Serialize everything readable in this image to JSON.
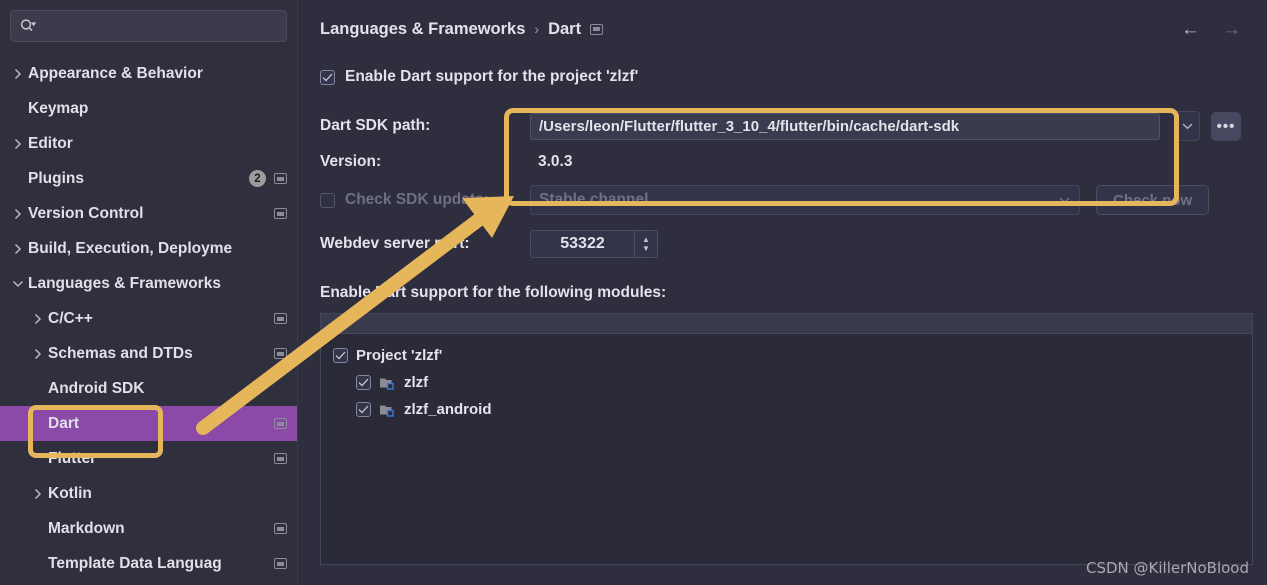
{
  "sidebar": {
    "search": {
      "placeholder": "",
      "value": "",
      "icon": "search-icon"
    },
    "items": [
      {
        "label": "Appearance & Behavior",
        "indent": 0,
        "chevron": "collapsed",
        "badge": null,
        "scope_icon": false,
        "selected": false
      },
      {
        "label": "Keymap",
        "indent": 0,
        "chevron": "none",
        "badge": null,
        "scope_icon": false,
        "selected": false
      },
      {
        "label": "Editor",
        "indent": 0,
        "chevron": "collapsed",
        "badge": null,
        "scope_icon": false,
        "selected": false
      },
      {
        "label": "Plugins",
        "indent": 0,
        "chevron": "none",
        "badge": "2",
        "scope_icon": true,
        "selected": false
      },
      {
        "label": "Version Control",
        "indent": 0,
        "chevron": "collapsed",
        "badge": null,
        "scope_icon": true,
        "selected": false
      },
      {
        "label": "Build, Execution, Deployme",
        "indent": 0,
        "chevron": "collapsed",
        "badge": null,
        "scope_icon": false,
        "selected": false
      },
      {
        "label": "Languages & Frameworks",
        "indent": 0,
        "chevron": "expanded",
        "badge": null,
        "scope_icon": false,
        "selected": false
      },
      {
        "label": "C/C++",
        "indent": 1,
        "chevron": "collapsed",
        "badge": null,
        "scope_icon": true,
        "selected": false
      },
      {
        "label": "Schemas and DTDs",
        "indent": 1,
        "chevron": "collapsed",
        "badge": null,
        "scope_icon": true,
        "selected": false
      },
      {
        "label": "Android SDK",
        "indent": 1,
        "chevron": "none",
        "badge": null,
        "scope_icon": false,
        "selected": false
      },
      {
        "label": "Dart",
        "indent": 1,
        "chevron": "none",
        "badge": null,
        "scope_icon": true,
        "selected": true
      },
      {
        "label": "Flutter",
        "indent": 1,
        "chevron": "none",
        "badge": null,
        "scope_icon": true,
        "selected": false
      },
      {
        "label": "Kotlin",
        "indent": 1,
        "chevron": "collapsed",
        "badge": null,
        "scope_icon": false,
        "selected": false
      },
      {
        "label": "Markdown",
        "indent": 1,
        "chevron": "none",
        "badge": null,
        "scope_icon": true,
        "selected": false
      },
      {
        "label": "Template Data Languag",
        "indent": 1,
        "chevron": "none",
        "badge": null,
        "scope_icon": true,
        "selected": false
      }
    ]
  },
  "header": {
    "breadcrumb_parent": "Languages & Frameworks",
    "breadcrumb_sep": "›",
    "breadcrumb_current": "Dart",
    "back_arrow": "←",
    "forward_arrow": "→"
  },
  "main": {
    "enable_dart_label": "Enable Dart support for the project 'zlzf'",
    "enable_dart_checked": true,
    "sdk_path_label": "Dart SDK path:",
    "sdk_path_value": "/Users/leon/Flutter/flutter_3_10_4/flutter/bin/cache/dart-sdk",
    "sdk_path_dropdown_icon": "chevron-down-icon",
    "browse_button_label": "•••",
    "version_label": "Version:",
    "version_value": "3.0.3",
    "check_sdk_label": "Check SDK update:",
    "check_sdk_checked": false,
    "channel_value": "Stable channel",
    "channel_chevron": "⌄",
    "check_now_label": "Check now",
    "webdev_label": "Webdev server port:",
    "webdev_value": "53322",
    "spinner_up": "▲",
    "spinner_down": "▼",
    "modules_title": "Enable Dart support for the following modules:",
    "modules": [
      {
        "label": "Project 'zlzf'",
        "level": 1,
        "checked": true,
        "folder": false
      },
      {
        "label": "zlzf",
        "level": 2,
        "checked": true,
        "folder": true
      },
      {
        "label": "zlzf_android",
        "level": 2,
        "checked": true,
        "folder": true
      }
    ]
  },
  "annotations": {
    "highlight_color": "#e5b65a",
    "sdk_box_name": "sdk-path-highlight",
    "dart_box_name": "dart-item-highlight",
    "arrow_name": "annotation-arrow"
  },
  "watermark": "CSDN @KillerNoBlood"
}
